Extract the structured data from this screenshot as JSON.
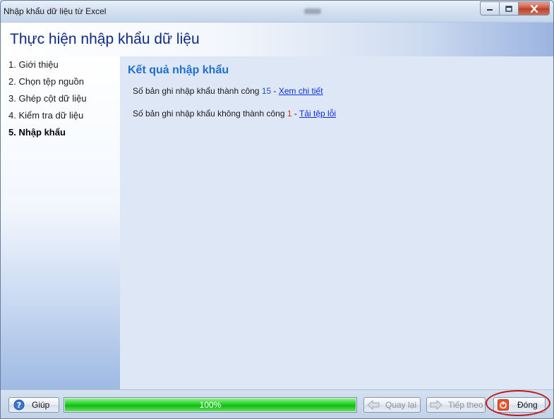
{
  "window": {
    "title": "Nhập khẩu dữ liệu từ Excel",
    "controls": [
      "minimize-icon",
      "maximize-icon",
      "close-icon"
    ]
  },
  "header": {
    "title": "Thực hiện nhập khẩu dữ liệu"
  },
  "sidebar": {
    "steps": [
      {
        "label": "1. Giới thiệu",
        "active": false
      },
      {
        "label": "2. Chọn tệp nguồn",
        "active": false
      },
      {
        "label": "3. Ghép cột dữ liệu",
        "active": false
      },
      {
        "label": "4. Kiểm tra dữ liệu",
        "active": false
      },
      {
        "label": "5. Nhập khẩu",
        "active": true
      }
    ]
  },
  "main": {
    "title": "Kết quả nhập khẩu",
    "success": {
      "prefix": "Số bản ghi nhập khẩu thành công",
      "count": "15",
      "separator": "-",
      "link": "Xem chi tiết"
    },
    "failure": {
      "prefix": "Số bản ghi nhập khẩu không thành công",
      "count": "1",
      "separator": "-",
      "link": "Tải tệp lỗi"
    }
  },
  "footer": {
    "help_label": "Giúp",
    "progress_text": "100%",
    "progress_value": 1.0,
    "back_label": "Quay lại",
    "next_label": "Tiếp theo",
    "close_label": "Đóng"
  },
  "colors": {
    "title_blue": "#0f2a82",
    "heading_blue": "#1f6fd1",
    "progress_green": "#22d022",
    "fail_red": "#e0312b",
    "highlight_red": "#c01818"
  }
}
